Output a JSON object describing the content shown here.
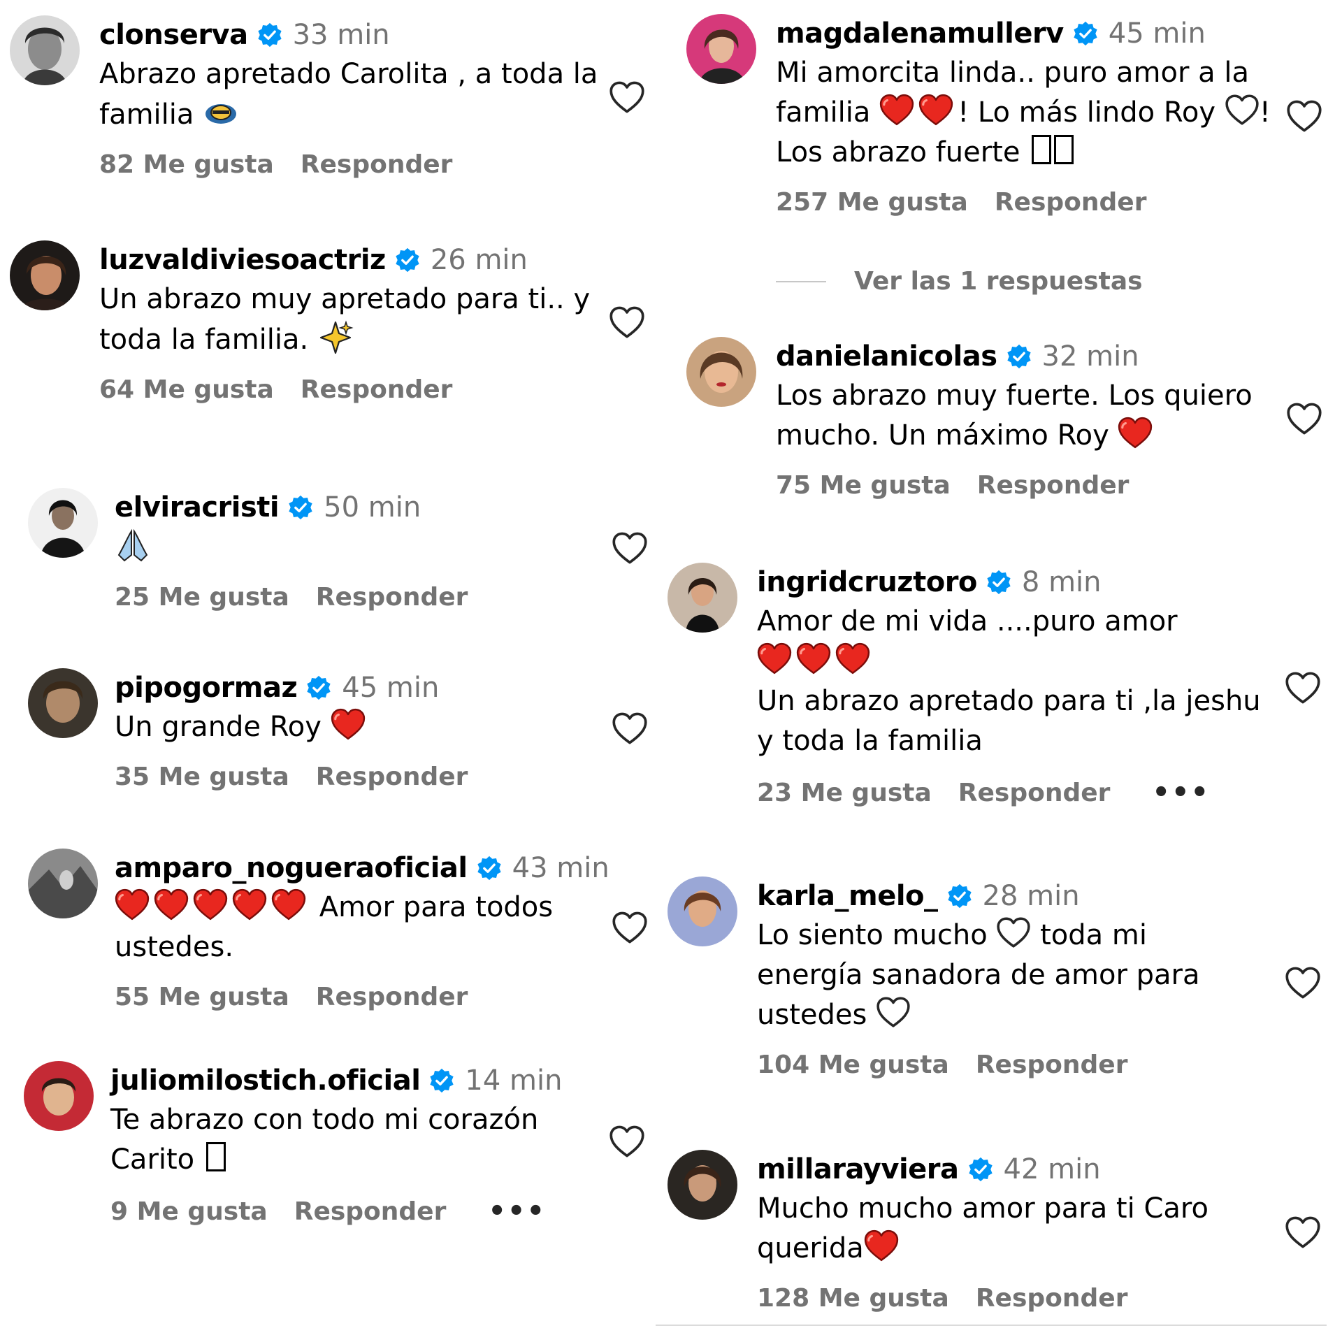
{
  "like_suffix": "Me gusta",
  "reply_label": "Responder",
  "more_label": "•••",
  "comments": [
    {
      "user": "clonserva",
      "time": "33 min",
      "lines": [
        "Abrazo apretado Carolita , a toda la",
        "familia"
      ],
      "likes": "82"
    },
    {
      "user": "luzvaldiviesoactriz",
      "time": "26 min",
      "lines": [
        "Un abrazo muy apretado para ti.. y",
        "toda la familia."
      ],
      "likes": "64"
    },
    {
      "user": "elviracristi",
      "time": "50 min",
      "lines": [
        ""
      ],
      "likes": "25"
    },
    {
      "user": "pipogormaz",
      "time": "45 min",
      "lines": [
        "Un grande Roy"
      ],
      "likes": "35"
    },
    {
      "user": "amparo_nogueraoficial",
      "time": "43 min",
      "lines": [
        "Amor para todos",
        "ustedes."
      ],
      "likes": "55"
    },
    {
      "user": "juliomilostich.oficial",
      "time": "14 min",
      "lines": [
        "Te abrazo con todo mi corazón",
        "Carito"
      ],
      "likes": "9"
    },
    {
      "user": "magdalenamullerv",
      "time": "45 min",
      "lines": [
        "Mi amorcita linda.. puro amor a la",
        "familia",
        "! Lo más lindo Roy",
        "!",
        "Los abrazo fuerte"
      ],
      "likes": "257"
    },
    {
      "user": "danielanicolas",
      "time": "32 min",
      "lines": [
        "Los abrazo muy fuerte. Los quiero",
        "mucho. Un máximo Roy"
      ],
      "likes": "75"
    },
    {
      "user": "ingridcruztoro",
      "time": "8 min",
      "lines": [
        "Amor de mi vida ....puro amor",
        "",
        "Un abrazo apretado para ti ,la jeshu",
        "y toda la familia"
      ],
      "likes": "23"
    },
    {
      "user": "karla_melo_",
      "time": "28 min",
      "lines": [
        "Lo siento mucho",
        "toda mi",
        "energía sanadora de amor para",
        "ustedes"
      ],
      "likes": "104"
    },
    {
      "user": "millarayviera",
      "time": "42 min",
      "lines": [
        "Mucho mucho amor para ti Caro",
        "querida"
      ],
      "likes": "128"
    }
  ],
  "view_replies": "Ver las 1 respuestas",
  "colors": {
    "verified": "#0095f6",
    "muted": "#737373",
    "heart": "#e0245e"
  }
}
